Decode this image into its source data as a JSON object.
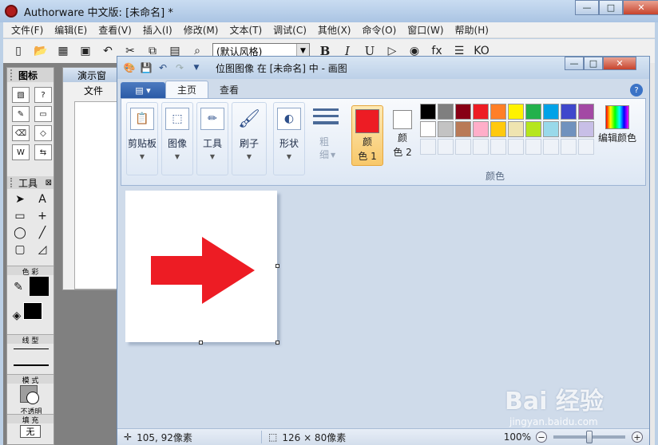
{
  "app": {
    "title": "Authorware 中文版: [未命名] *",
    "menu": [
      "文件(F)",
      "编辑(E)",
      "查看(V)",
      "插入(I)",
      "修改(M)",
      "文本(T)",
      "调试(C)",
      "其他(X)",
      "命令(O)",
      "窗口(W)",
      "帮助(H)"
    ],
    "style_select": "(默认风格)",
    "win_buttons": {
      "min": "—",
      "max": "□",
      "close": "✕"
    }
  },
  "icon_palette": {
    "title": "图标",
    "tools_title": "工具",
    "tools_close": "⊠",
    "labels": {
      "color": "色 彩",
      "line": "线 型",
      "mode": "模 式",
      "opaque": "不透明",
      "fill": "填 充",
      "fill_none": "无"
    }
  },
  "demo_window": {
    "title": "演示窗",
    "menu": "文件"
  },
  "paint": {
    "title": "位图图像 在 [未命名] 中 - 画图",
    "tabs": [
      "主页",
      "查看"
    ],
    "groups": {
      "clipboard": "剪贴板",
      "image": "图像",
      "tools": "工具",
      "brush": "刷子",
      "shapes": "形状",
      "thickness": "粗\n细",
      "color1": "颜\n色 1",
      "color2": "颜\n色 2",
      "colors_caption": "颜色",
      "edit_colors": "编辑颜色"
    },
    "colors": {
      "color1": "#ed1c24",
      "color2": "#ffffff",
      "row1": [
        "#000000",
        "#7f7f7f",
        "#880015",
        "#ed1c24",
        "#ff7f27",
        "#fff200",
        "#22b14c",
        "#00a2e8",
        "#3f48cc",
        "#a349a4"
      ],
      "row2": [
        "#ffffff",
        "#c3c3c3",
        "#b97a57",
        "#ffaec9",
        "#ffc90e",
        "#efe4b0",
        "#b5e61d",
        "#99d9ea",
        "#7092be",
        "#c8bfe7"
      ],
      "arrow": "#ed1c24"
    },
    "status": {
      "cursor": "105, 92像素",
      "selection": "126 × 80像素",
      "zoom": "100%",
      "zoom_fraction": 0.5
    }
  },
  "watermark": {
    "main": "Bai 经验",
    "sub": "jingyan.baidu.com"
  }
}
